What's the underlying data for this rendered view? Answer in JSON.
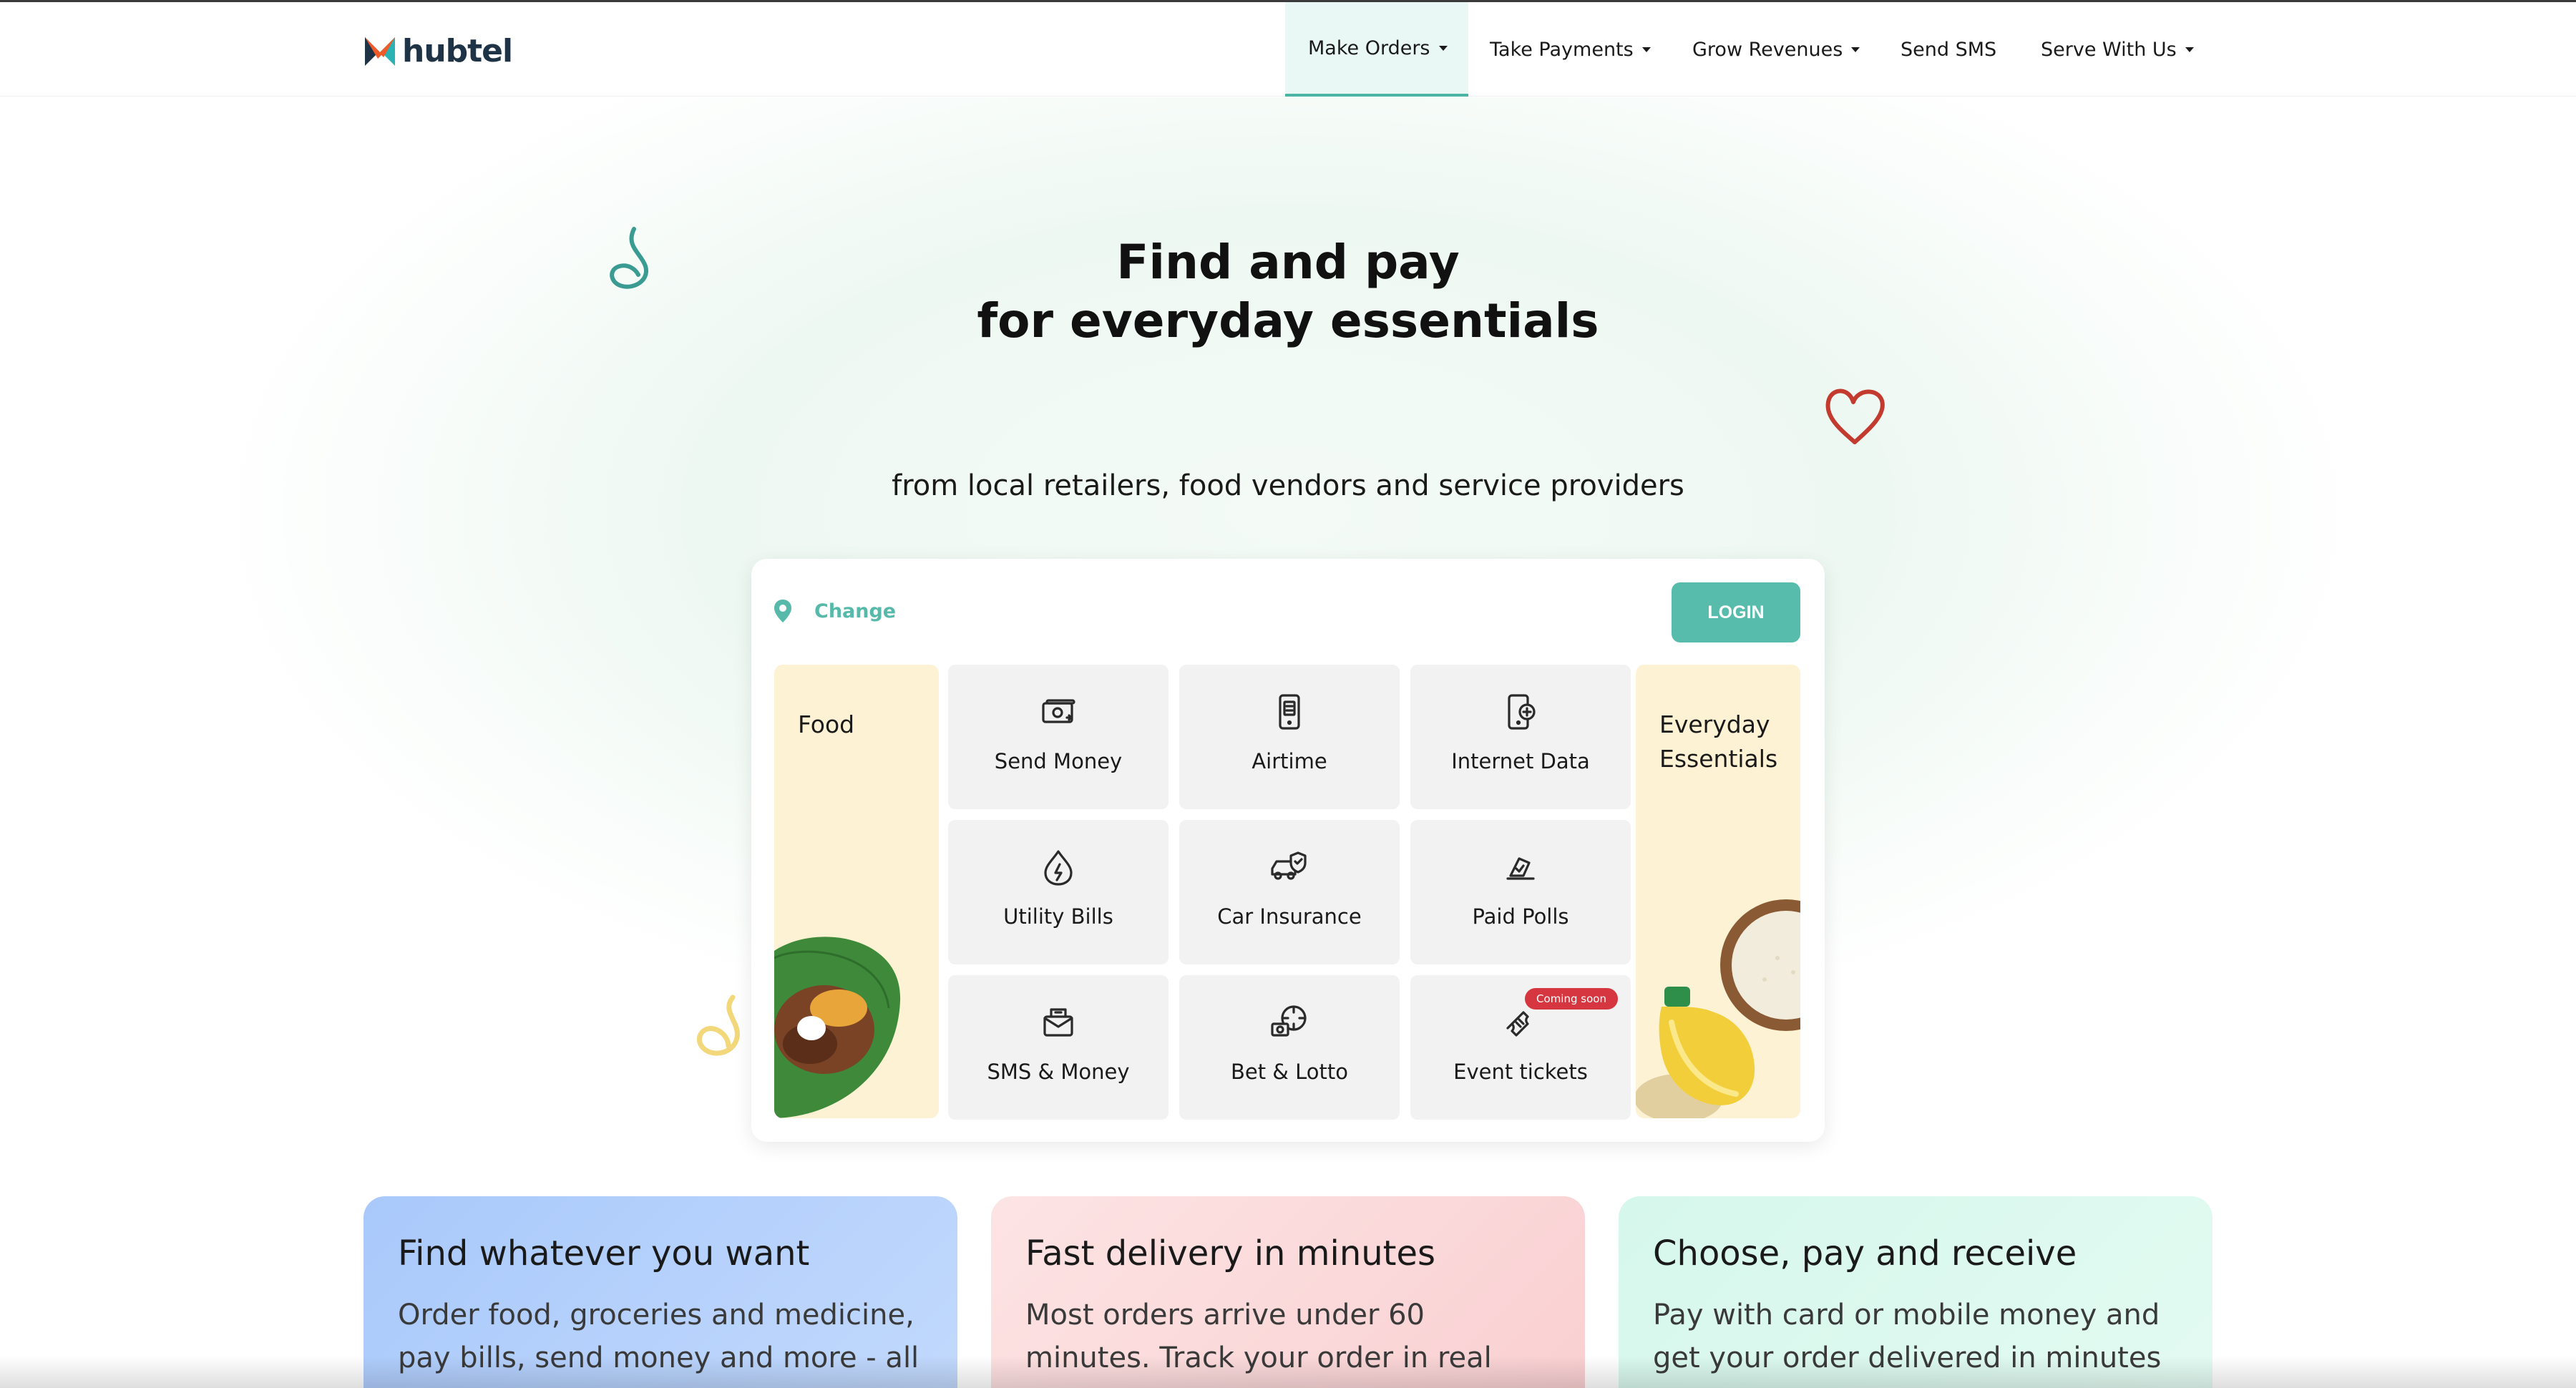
{
  "brand": {
    "name": "hubtel",
    "colors": {
      "accent": "#58bcac",
      "navy": "#1f3347",
      "orange": "#f05a28",
      "teal": "#2bb3b3"
    }
  },
  "nav": {
    "items": [
      {
        "label": "Make Orders",
        "dropdown": true,
        "active": true
      },
      {
        "label": "Take Payments",
        "dropdown": true
      },
      {
        "label": "Grow Revenues",
        "dropdown": true
      },
      {
        "label": "Send SMS",
        "dropdown": false
      },
      {
        "label": "Serve With Us",
        "dropdown": true
      }
    ]
  },
  "hero": {
    "title_line1": "Find and pay",
    "title_line2": "for everyday essentials",
    "subtitle": "from local retailers, food vendors and service providers"
  },
  "card": {
    "location_label": "Change",
    "login_label": "LOGIN",
    "food_label": "Food",
    "essentials_label_line1": "Everyday",
    "essentials_label_line2": "Essentials",
    "tiles": [
      {
        "label": "Send Money",
        "icon": "send-money-icon"
      },
      {
        "label": "Airtime",
        "icon": "airtime-icon"
      },
      {
        "label": "Internet Data",
        "icon": "internet-data-icon"
      },
      {
        "label": "Utility Bills",
        "icon": "utility-bills-icon"
      },
      {
        "label": "Car Insurance",
        "icon": "car-insurance-icon"
      },
      {
        "label": "Paid Polls",
        "icon": "paid-polls-icon"
      },
      {
        "label": "SMS & Money",
        "icon": "sms-money-icon"
      },
      {
        "label": "Bet & Lotto",
        "icon": "bet-lotto-icon"
      },
      {
        "label": "Event tickets",
        "icon": "event-tickets-icon",
        "badge": "Coming soon"
      }
    ]
  },
  "features": [
    {
      "title": "Find whatever you want",
      "text": "Order food, groceries and medicine, pay bills, send money and more - all"
    },
    {
      "title": "Fast delivery in minutes",
      "text": "Most orders arrive under 60 minutes. Track your order in real"
    },
    {
      "title": "Choose, pay and receive",
      "text": "Pay with card or mobile money and get your order delivered in minutes"
    }
  ]
}
